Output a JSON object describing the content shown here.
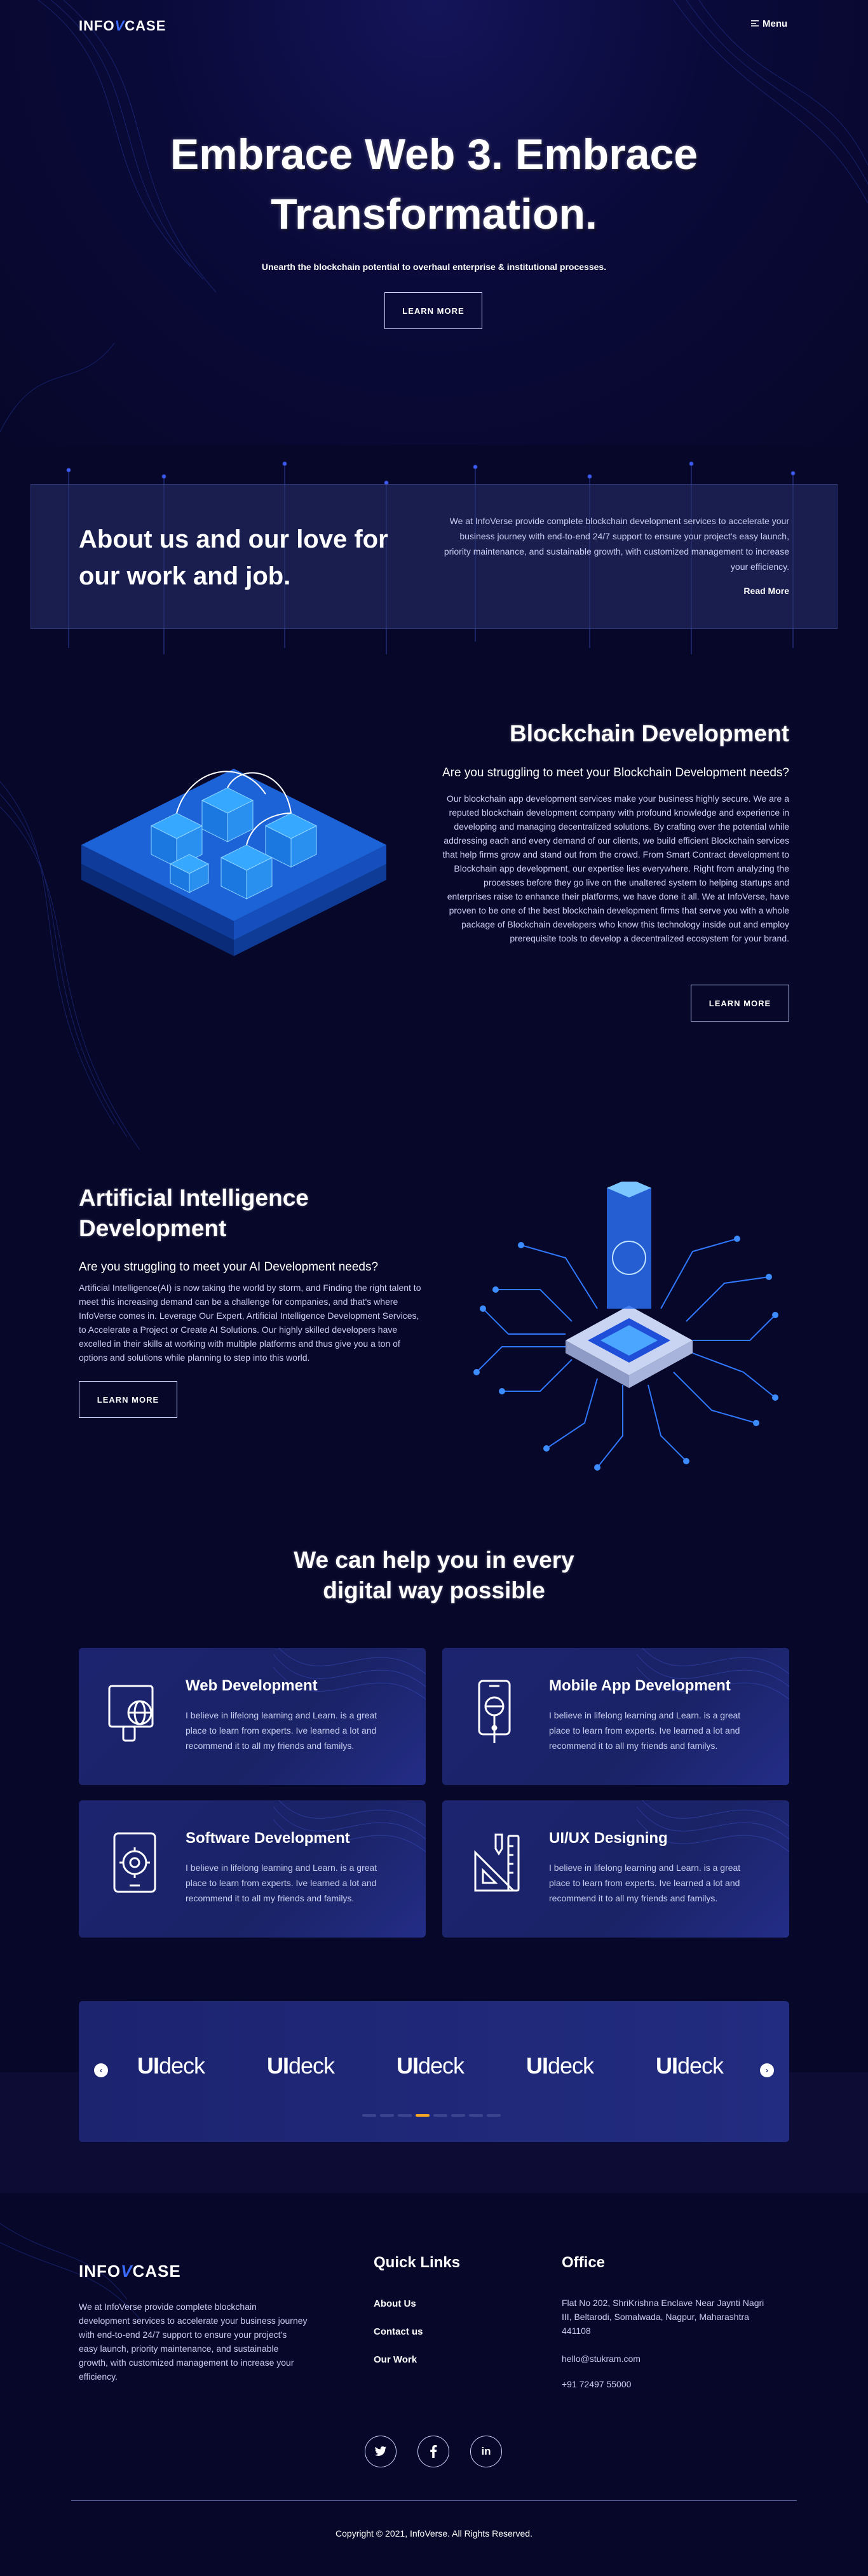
{
  "nav": {
    "logo_left": "INFO",
    "logo_mid": "V",
    "logo_right": "CASE",
    "menu_label": "Menu"
  },
  "hero": {
    "title_line1": "Embrace Web 3. Embrace",
    "title_line2": "Transformation.",
    "subtitle": "Unearth the blockchain potential to overhaul enterprise & institutional processes.",
    "cta": "LEARN MORE"
  },
  "about": {
    "title_line1": "About us and our love for",
    "title_line2": "our work and job.",
    "text": "We at InfoVerse provide complete blockchain development services to accelerate your business journey with end-to-end 24/7 support to ensure your project's easy launch, priority maintenance, and sustainable growth, with customized management to increase your efficiency.",
    "read_more": "Read More"
  },
  "blockchain": {
    "title": "Blockchain Development",
    "question": "Are you struggling to meet your Blockchain Development needs?",
    "text": "Our blockchain app development services make your business highly secure. We are a reputed blockchain development company with profound knowledge and experience in developing and managing decentralized solutions. By crafting over the potential while addressing each and every demand of our clients, we build efficient Blockchain services that help firms grow and stand out from the crowd. From Smart Contract development to Blockchain app development, our expertise lies everywhere. Right from analyzing the processes before they go live on the unaltered system to helping startups and enterprises raise to enhance their platforms, we have done it all. We at InfoVerse, have proven to be one of the best blockchain development firms that serve you with a whole package of Blockchain developers who know this technology inside out and employ prerequisite tools to develop a decentralized ecosystem for your brand.",
    "cta": "LEARN MORE"
  },
  "ai": {
    "title_line1": "Artificial Intelligence",
    "title_line2": "Development",
    "question": "Are you struggling to meet your AI Development needs?",
    "text": "Artificial Intelligence(AI) is now taking the world by storm, and Finding the right talent to meet this increasing demand can be a challenge for companies, and that's where InfoVerse comes in. Leverage Our Expert, Artificial Intelligence Development Services, to Accelerate a Project or Create AI Solutions. Our highly skilled developers have excelled in their skills at working with multiple platforms and thus give you a ton of options and solutions while planning to step into this world.",
    "cta": "LEARN MORE"
  },
  "services": {
    "title_line1": "We can help you in every",
    "title_line2": "digital way possible",
    "items": [
      {
        "title": "Web Development",
        "text": "I believe in lifelong learning and Learn. is a great place to learn from experts. Ive learned a lot and recommend it to all my friends and familys.",
        "icon": "web-dev-icon"
      },
      {
        "title": "Mobile App Development",
        "text": "I believe in lifelong learning and Learn. is a great place to learn from experts. Ive learned a lot and recommend it to all my friends and familys.",
        "icon": "mobile-app-icon"
      },
      {
        "title": "Software Development",
        "text": "I believe in lifelong learning and Learn. is a great place to learn from experts. Ive learned a lot and recommend it to all my friends and familys.",
        "icon": "software-icon"
      },
      {
        "title": "UI/UX Designing",
        "text": "I believe in lifelong learning and Learn. is a great place to learn from experts. Ive learned a lot and recommend it to all my friends and familys.",
        "icon": "design-tools-icon"
      }
    ]
  },
  "carousel": {
    "brand_ui": "UI",
    "brand_rest": "deck",
    "prev": "‹",
    "next": "›",
    "dot_count": 8,
    "active_dot": 4
  },
  "footer": {
    "about_text": "We at InfoVerse provide complete blockchain development services to accelerate your business journey with end-to-end 24/7 support to ensure your project's easy launch, priority maintenance, and sustainable growth, with customized management to increase your efficiency.",
    "quick_links_title": "Quick Links",
    "links": [
      "About Us",
      "Contact us",
      "Our Work"
    ],
    "office_title": "Office",
    "address": "Flat No 202, ShriKrishna Enclave Near Jaynti Nagri III, Beltarodi, Somalwada, Nagpur, Maharashtra 441108",
    "email": "hello@stukram.com",
    "phone": "+91 72497 55000",
    "social": [
      "twitter",
      "facebook",
      "linkedin"
    ],
    "copyright": "Copyright © 2021, InfoVerse. All Rights Reserved."
  },
  "colors": {
    "background": "#07072a",
    "card": "#1c2470",
    "accent": "#3b6cff",
    "active_dot": "#f5a623"
  }
}
